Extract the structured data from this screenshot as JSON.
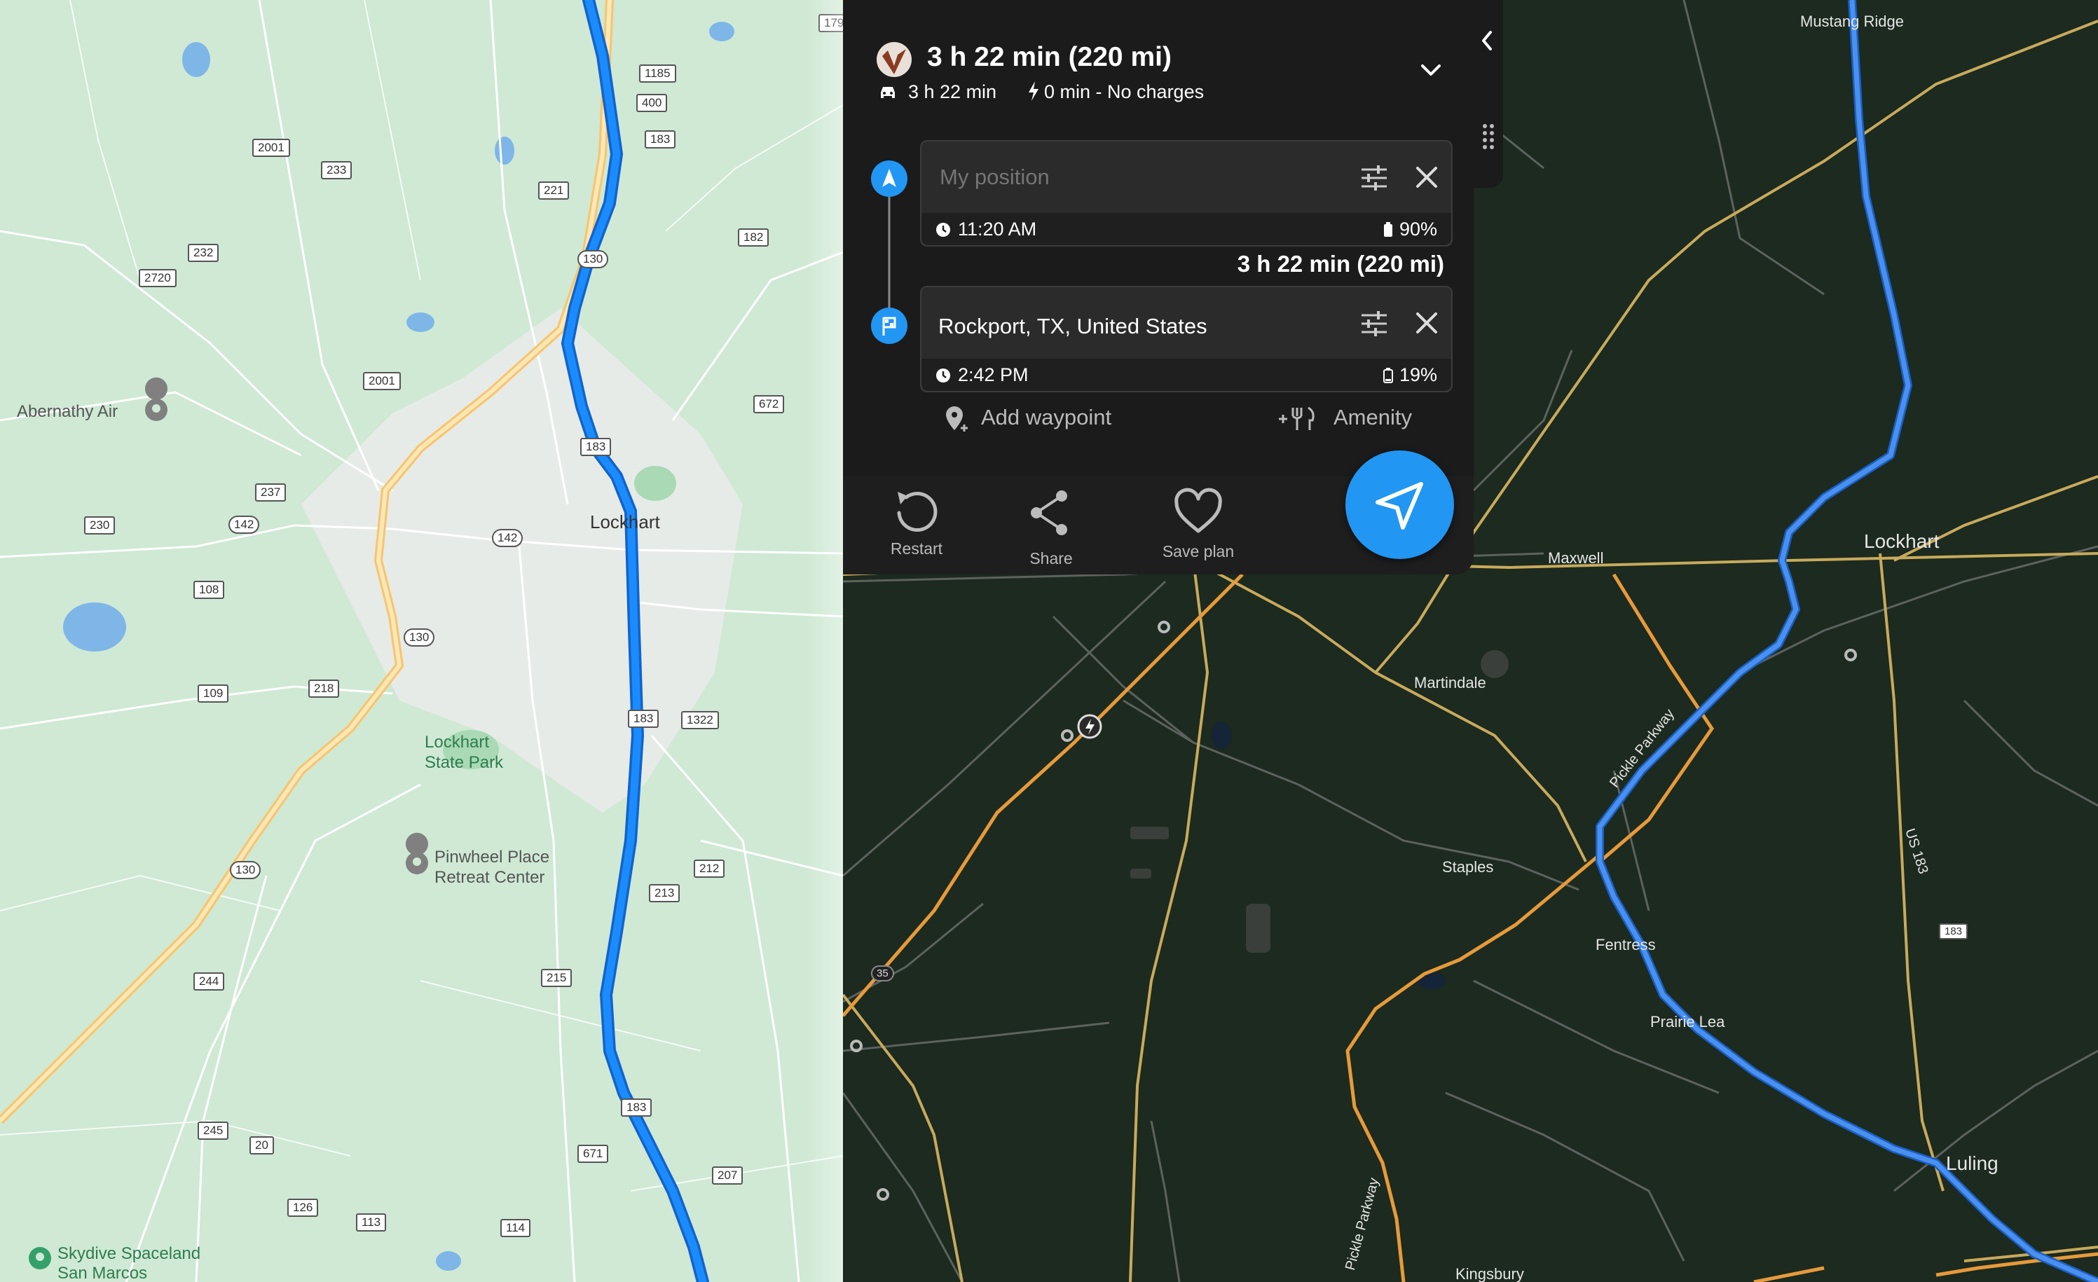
{
  "route": {
    "summary_title": "3 h 22 min (220 mi)",
    "drive_time": "3 h 22 min",
    "charge_info": "0 min - No charges",
    "leg_summary": "3 h 22 min (220 mi)"
  },
  "origin": {
    "placeholder": "My position",
    "time": "11:20 AM",
    "battery": "90%"
  },
  "destination": {
    "value": "Rockport, TX, United States",
    "time": "2:42 PM",
    "battery": "19%"
  },
  "links": {
    "add_waypoint": "Add waypoint",
    "amenity": "Amenity"
  },
  "actions": {
    "restart": "Restart",
    "share": "Share",
    "save_plan": "Save plan"
  },
  "map_light": {
    "labels": {
      "abernathy": "Abernathy Air",
      "lockhart": "Lockhart",
      "state_park": "Lockhart\nState Park",
      "state_park_1": "Lockhart",
      "state_park_2": "State Park",
      "pinwheel_1": "Pinwheel Place",
      "pinwheel_2": "Retreat Center",
      "skydive_1": "Skydive Spaceland",
      "skydive_2": "San Marcos"
    },
    "shields": [
      "1185",
      "400",
      "183",
      "2001",
      "233",
      "221",
      "232",
      "2720",
      "130",
      "182",
      "2001",
      "672",
      "183",
      "237",
      "230",
      "142",
      "142",
      "108",
      "130",
      "218",
      "109",
      "183",
      "1322",
      "212",
      "130",
      "213",
      "215",
      "244",
      "245",
      "20",
      "183",
      "671",
      "207",
      "126",
      "113",
      "114",
      "179"
    ]
  },
  "map_dark": {
    "labels": {
      "mustang_ridge": "Mustang Ridge",
      "lockhart": "Lockhart",
      "maxwell": "Maxwell",
      "martindale": "Martindale",
      "staples": "Staples",
      "fentress": "Fentress",
      "prairie_lea": "Prairie Lea",
      "luling": "Luling",
      "kingsbury": "Kingsbury",
      "pickle_parkway": "Pickle Parkway",
      "pickle_parkway_2": "Pickle Parkway",
      "us183": "US 183"
    },
    "shields": [
      "35",
      "183"
    ]
  },
  "colors": {
    "route_blue": "#1a73e8",
    "accent": "#2196f3",
    "panel_bg": "#1b1b1b"
  }
}
